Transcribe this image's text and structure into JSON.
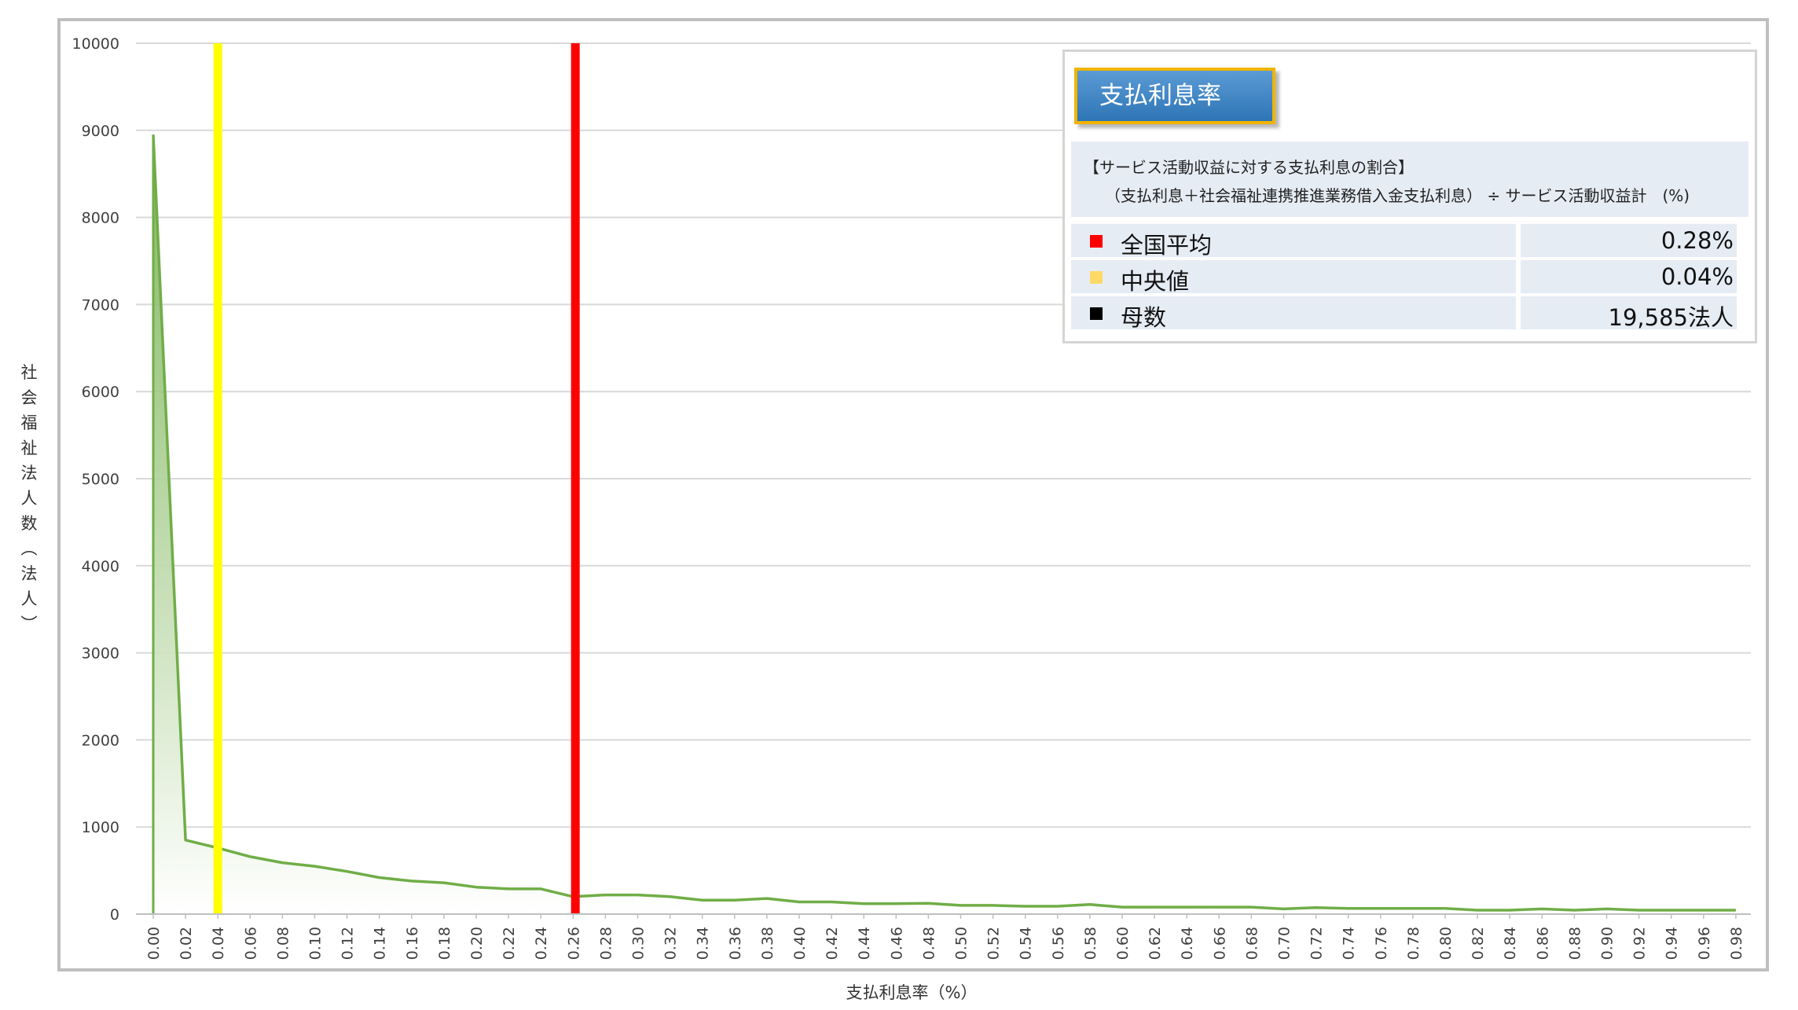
{
  "chart_data": {
    "type": "area",
    "xlabel": "支払利息率（%）",
    "ylabel": "社会福祉法人数（法人）",
    "ylim": [
      0,
      10000
    ],
    "yticks": [
      0,
      1000,
      2000,
      3000,
      4000,
      5000,
      6000,
      7000,
      8000,
      9000,
      10000
    ],
    "x": [
      "0.00",
      "0.02",
      "0.04",
      "0.06",
      "0.08",
      "0.10",
      "0.12",
      "0.14",
      "0.16",
      "0.18",
      "0.20",
      "0.22",
      "0.24",
      "0.26",
      "0.28",
      "0.30",
      "0.32",
      "0.34",
      "0.36",
      "0.38",
      "0.40",
      "0.42",
      "0.44",
      "0.46",
      "0.48",
      "0.50",
      "0.52",
      "0.54",
      "0.56",
      "0.58",
      "0.60",
      "0.62",
      "0.64",
      "0.66",
      "0.68",
      "0.70",
      "0.72",
      "0.74",
      "0.76",
      "0.78",
      "0.80",
      "0.82",
      "0.84",
      "0.86",
      "0.88",
      "0.90",
      "0.92",
      "0.94",
      "0.96",
      "0.98"
    ],
    "values": [
      8950,
      850,
      760,
      660,
      590,
      550,
      490,
      420,
      380,
      360,
      310,
      290,
      290,
      200,
      220,
      220,
      200,
      160,
      160,
      180,
      140,
      140,
      120,
      120,
      125,
      100,
      100,
      90,
      90,
      110,
      80,
      80,
      80,
      80,
      80,
      60,
      75,
      65,
      65,
      65,
      65,
      45,
      45,
      60,
      45,
      60,
      45,
      45,
      45,
      45
    ],
    "grid": true,
    "series_color": "#70ad47",
    "fill_color_top": "#70ad47",
    "fill_color_bottom": "#ffffff",
    "reference_lines": [
      {
        "x": 0.04,
        "color": "#ffff00"
      },
      {
        "x": 0.2614,
        "color": "#ff0000"
      }
    ]
  },
  "legend": {
    "title": "支払利息率",
    "definition_line1": "【サービス活動収益に対する支払利息の割合】",
    "definition_line2": "（支払利息＋社会福祉連携推進業務借入金支払利息） ÷ サービス活動収益計　(%)",
    "rows": [
      {
        "label": "全国平均",
        "value": "0.28%",
        "color": "#ff0000"
      },
      {
        "label": "中央値",
        "value": "0.04%",
        "color": "#ffd966"
      },
      {
        "label": "母数",
        "value": "19,585法人",
        "color": "#000000"
      }
    ]
  }
}
